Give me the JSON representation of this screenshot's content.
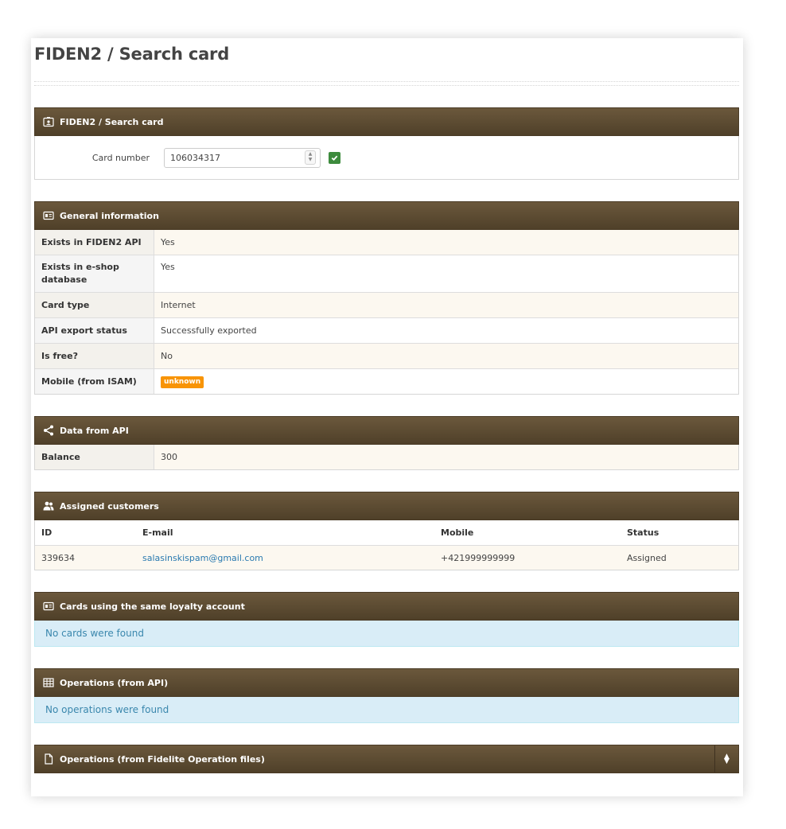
{
  "page": {
    "title": "FIDEN2 / Search card"
  },
  "search_panel": {
    "title": "FIDEN2 / Search card",
    "card_number_label": "Card number",
    "card_number_value": "106034317"
  },
  "general": {
    "title": "General information",
    "rows": [
      {
        "label": "Exists in FIDEN2 API",
        "value": "Yes"
      },
      {
        "label": "Exists in e-shop database",
        "value": "Yes"
      },
      {
        "label": "Card type",
        "value": "Internet"
      },
      {
        "label": "API export status",
        "value": "Successfully exported"
      },
      {
        "label": "Is free?",
        "value": "No"
      },
      {
        "label": "Mobile (from ISAM)",
        "value": "unknown"
      }
    ]
  },
  "api_data": {
    "title": "Data from API",
    "rows": [
      {
        "label": "Balance",
        "value": "300"
      }
    ]
  },
  "customers": {
    "title": "Assigned customers",
    "columns": [
      "ID",
      "E-mail",
      "Mobile",
      "Status"
    ],
    "rows": [
      {
        "id": "339634",
        "email": "salasinskispam@gmail.com",
        "mobile": "+421999999999",
        "status": "Assigned"
      }
    ]
  },
  "same_account": {
    "title": "Cards using the same loyalty account",
    "empty_text": "No cards were found"
  },
  "operations_api": {
    "title": "Operations (from API)",
    "empty_text": "No operations were found"
  },
  "operations_files": {
    "title": "Operations (from Fidelite Operation files)"
  },
  "colors": {
    "panel_header": "#5a4a33",
    "badge": "#f89406",
    "info_bg": "#d9edf7",
    "link": "#2a7ab0",
    "ok_button": "#3d8b3d"
  }
}
